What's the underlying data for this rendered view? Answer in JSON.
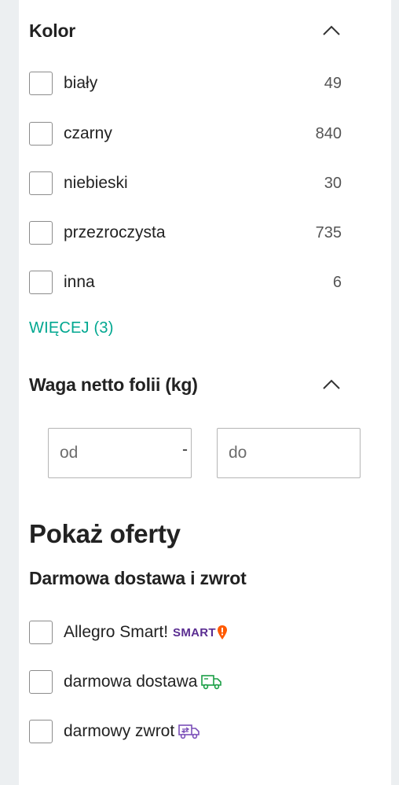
{
  "color_filter": {
    "title": "Kolor",
    "options": [
      {
        "label": "biały",
        "count": "49"
      },
      {
        "label": "czarny",
        "count": "840"
      },
      {
        "label": "niebieski",
        "count": "30"
      },
      {
        "label": "przezroczysta",
        "count": "735"
      },
      {
        "label": "inna",
        "count": "6"
      }
    ],
    "more_label": "WIĘCEJ (3)"
  },
  "weight_filter": {
    "title": "Waga netto folii (kg)",
    "from_placeholder": "od",
    "to_placeholder": "do",
    "separator": "-"
  },
  "offers": {
    "title": "Pokaż oferty",
    "subtitle": "Darmowa dostawa i zwrot",
    "options": [
      {
        "label": "Allegro Smart!",
        "badge": "SMART"
      },
      {
        "label": "darmowa dostawa",
        "icon": "delivery-truck-icon"
      },
      {
        "label": "darmowy zwrot",
        "icon": "return-truck-icon"
      }
    ]
  },
  "colors": {
    "accent": "#00a790",
    "smart_purple": "#5a2d91",
    "smart_orange": "#ff5a00",
    "delivery_green": "#1a9e45",
    "return_purple": "#7b4fb8"
  }
}
